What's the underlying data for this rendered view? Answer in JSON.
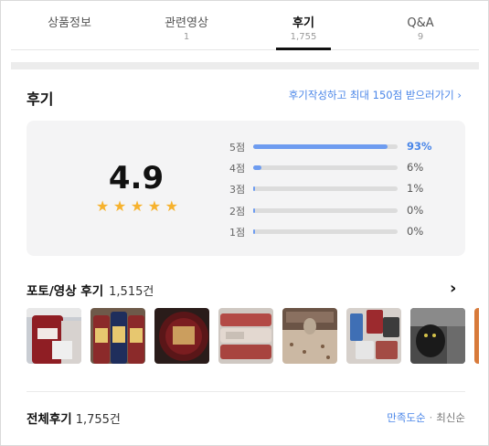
{
  "tabs": [
    {
      "label": "상품정보",
      "count": ""
    },
    {
      "label": "관련영상",
      "count": "1"
    },
    {
      "label": "후기",
      "count": "1,755"
    },
    {
      "label": "Q&A",
      "count": "9"
    }
  ],
  "review": {
    "title": "후기",
    "write_link": "후기작성하고 최대 150점 받으러가기",
    "link_chevron": "›"
  },
  "summary": {
    "score": "4.9",
    "stars": [
      "★",
      "★",
      "★",
      "★",
      "★"
    ],
    "distribution": [
      {
        "label": "5점",
        "percent": "93%",
        "value": 0.93
      },
      {
        "label": "4점",
        "percent": "6%",
        "value": 0.06
      },
      {
        "label": "3점",
        "percent": "1%",
        "value": 0.01
      },
      {
        "label": "2점",
        "percent": "0%",
        "value": 0.0
      },
      {
        "label": "1점",
        "percent": "0%",
        "value": 0.0
      }
    ]
  },
  "photo_reviews": {
    "title": "포토/영상 후기",
    "count": "1,515건",
    "arrow": "›"
  },
  "all_reviews": {
    "title": "전체후기",
    "count": "1,755건",
    "sort_selected": "만족도순",
    "sort_separator": "·",
    "sort_other": "최신순"
  }
}
